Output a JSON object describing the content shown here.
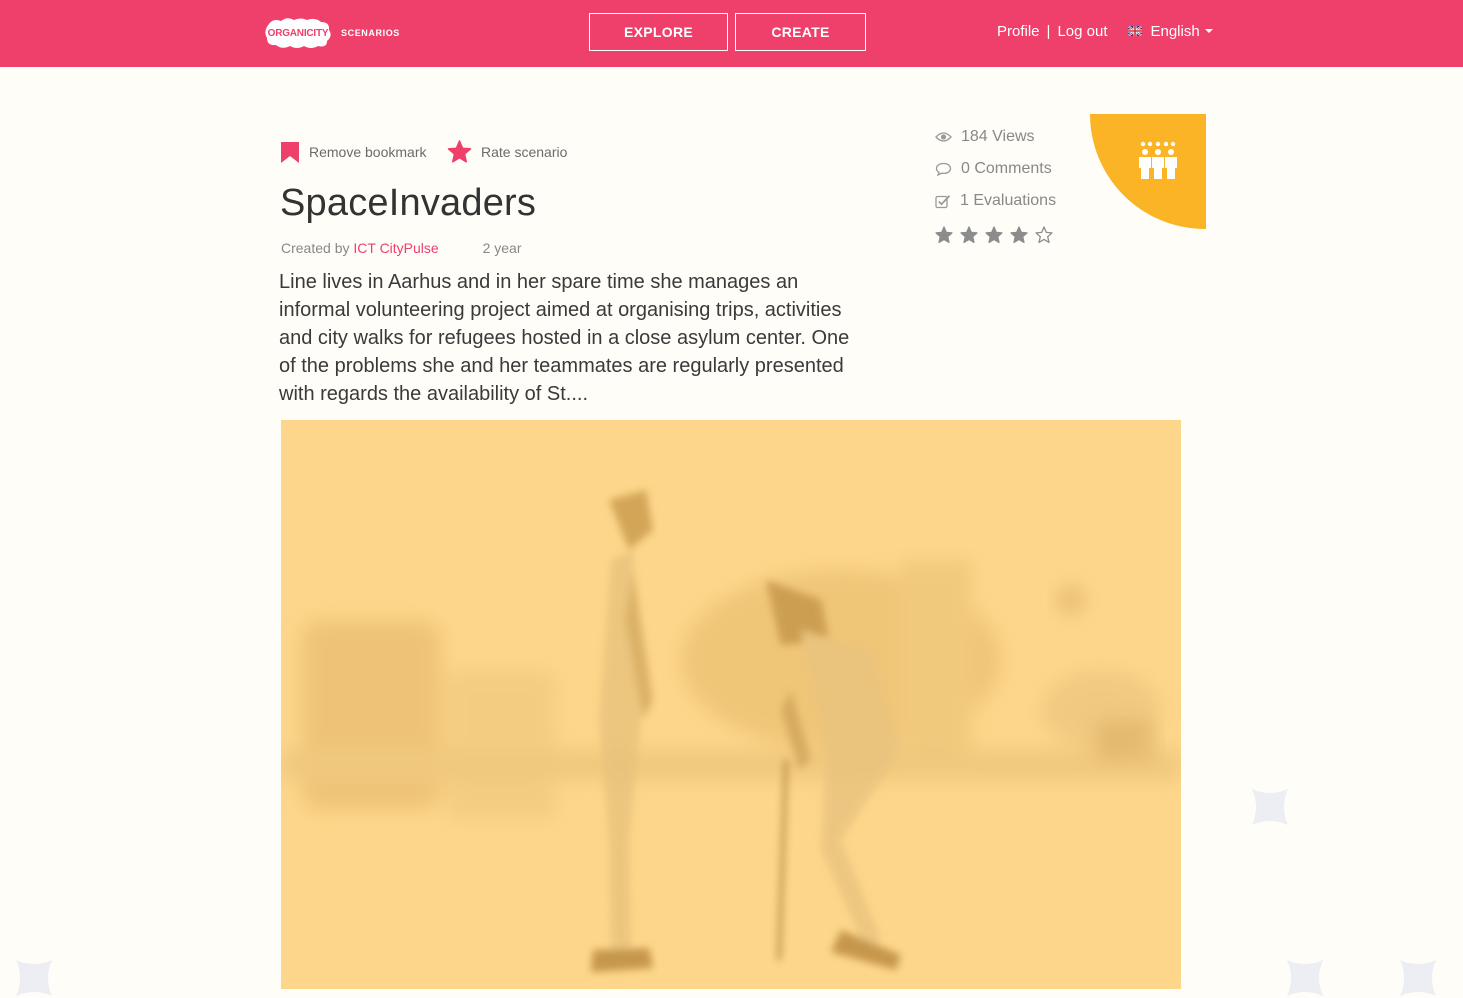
{
  "navbar": {
    "logo_text": "ORGANICITY",
    "logo_sub": "SCENARIOS",
    "explore_label": "EXPLORE",
    "create_label": "CREATE",
    "profile_label": "Profile",
    "separator": "|",
    "logout_label": "Log out",
    "language_label": "English",
    "flag_icon": "uk-flag-icon",
    "background_color": "#ef3f6b"
  },
  "actions": {
    "bookmark_label": "Remove bookmark",
    "rate_label": "Rate scenario"
  },
  "scenario": {
    "title": "SpaceInvaders",
    "created_by_prefix": "Created by",
    "author": "ICT CityPulse",
    "age": "2 year",
    "description": "Line lives in Aarhus and in her spare time she manages an informal volunteering project aimed at organising trips, activities and city walks for refugees hosted in a close asylum center. One of the problems she and her teammates are regularly presented with regards the availability of St....",
    "category_icon": "people-group-icon",
    "category_color": "#fbb426",
    "image_tint": "#fdd68b"
  },
  "stats": {
    "views": "184 Views",
    "comments": "0 Comments",
    "evaluations": "1 Evaluations",
    "rating": 4,
    "rating_max": 5
  },
  "colors": {
    "accent": "#ef3f6b",
    "page_background": "#fefdf8"
  }
}
